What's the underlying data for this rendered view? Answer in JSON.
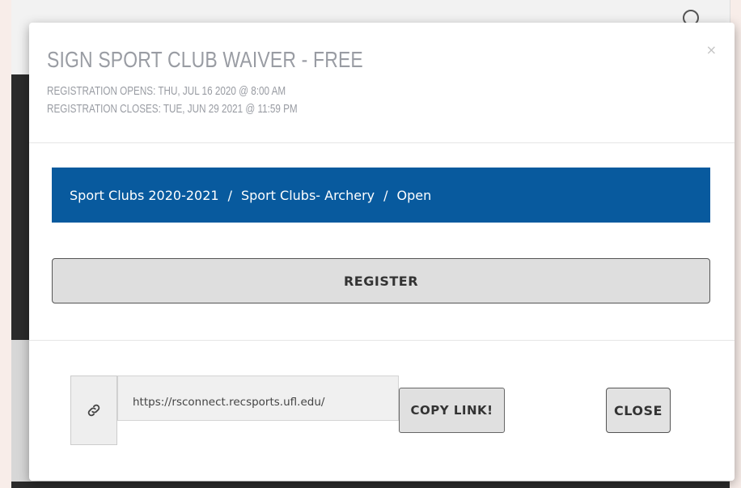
{
  "modal": {
    "title": "SIGN SPORT CLUB WAIVER - FREE",
    "registration_opens": "REGISTRATION OPENS: THU, JUL 16 2020 @ 8:00 AM",
    "registration_closes": "REGISTRATION CLOSES: TUE, JUN 29 2021 @ 11:59 PM",
    "close_icon": "×"
  },
  "breadcrumb": {
    "items": [
      "Sport Clubs 2020-2021",
      "Sport Clubs- Archery",
      "Open"
    ],
    "separator": "/",
    "background_color": "#085a9e"
  },
  "actions": {
    "register_label": "REGISTER",
    "link_url": "https://rsconnect.recsports.ufl.edu/",
    "link_icon": "link-icon",
    "copy_label": "COPY LINK!",
    "close_label": "CLOSE"
  }
}
